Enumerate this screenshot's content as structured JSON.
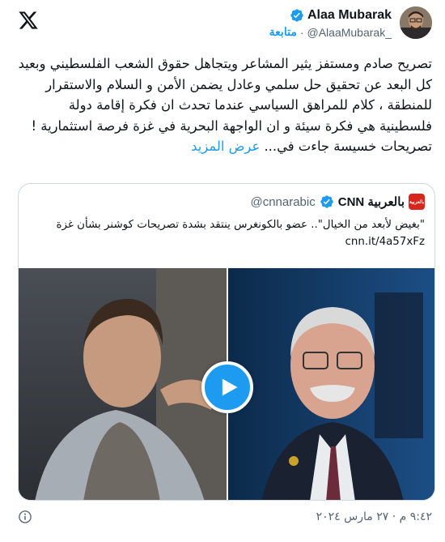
{
  "author": {
    "name": "Alaa Mubarak",
    "handle": "@AlaaMubarak_",
    "follow_label": "متابعة",
    "separator": "·"
  },
  "tweet": {
    "text": "تصريح صادم ومستفز يثير المشاعر ويتجاهل حقوق الشعب الفلسطيني وبعيد كل البعد عن تحقيق حل سلمي وعادل يضمن الأمن و السلام والاستقرار للمنطقة ، كلام للمراهق السياسي عندما تحدث ان فكرة إقامة دولة فلسطينية هي فكرة سيئة و ان الواجهة البحرية في غزة فرصة استثمارية ! تصريحات خسيسة جاءت في...",
    "show_more": "عرض المزيد"
  },
  "card": {
    "source_logo_text": "بالعربية",
    "source_name": "CNN بالعربية",
    "source_handle": "@cnnarabic",
    "text": "\"بغيض لأبعد من الخيال\".. عضو بالكونغرس ينتقد بشدة تصريحات كوشنر بشأن غزة",
    "link": "cnn.it/4a57xFz"
  },
  "footer": {
    "timestamp": "٩:٤٢ م · ٢٧ مارس ٢٠٢٤"
  },
  "colors": {
    "accent": "#1d9bf0",
    "text_primary": "#0f1419",
    "text_secondary": "#536471",
    "border": "#cfd9de"
  },
  "icons": {
    "logo": "x-logo-icon",
    "verified": "verified-badge-icon",
    "play": "play-icon",
    "info": "info-icon"
  }
}
